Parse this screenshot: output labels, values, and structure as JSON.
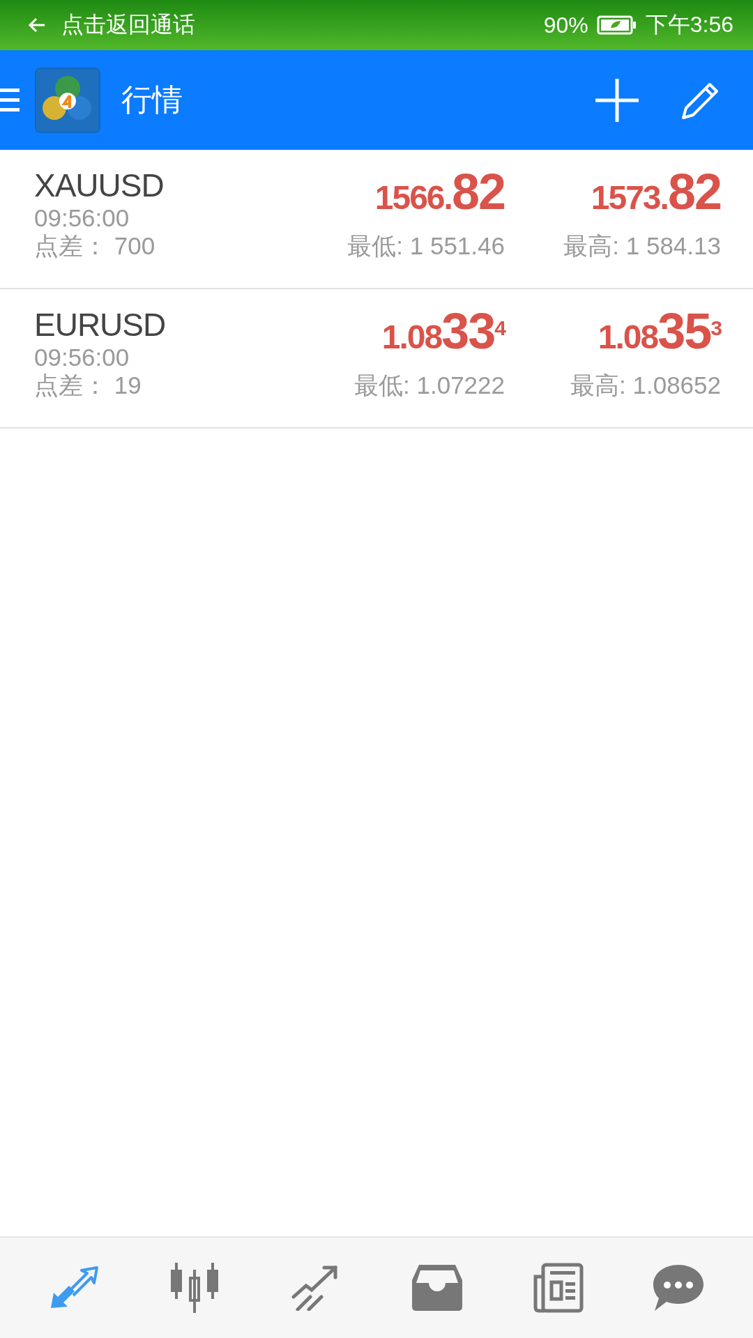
{
  "status_bar": {
    "back_label": "点击返回通话",
    "battery": "90%",
    "time": "下午3:56"
  },
  "toolbar": {
    "title": "行情"
  },
  "quotes": [
    {
      "symbol": "XAUUSD",
      "time": "09:56:00",
      "spread_label": "点差：",
      "spread": "700",
      "bid": {
        "prefix": "1566.",
        "big": "82"
      },
      "ask": {
        "prefix": "1573.",
        "big": "82"
      },
      "low": "最低: 1 551.46",
      "high": "最高: 1 584.13"
    },
    {
      "symbol": "EURUSD",
      "time": "09:56:00",
      "spread_label": "点差：",
      "spread": "19",
      "bid": {
        "prefix": "1.08",
        "big": "33",
        "sup": "4"
      },
      "ask": {
        "prefix": "1.08",
        "big": "35",
        "sup": "3"
      },
      "low": "最低: 1.07222",
      "high": "最高: 1.08652"
    }
  ],
  "bottom_nav": [
    {
      "kind": "quotes",
      "selected": true
    },
    {
      "kind": "chart",
      "selected": false
    },
    {
      "kind": "trade",
      "selected": false
    },
    {
      "kind": "history",
      "selected": false
    },
    {
      "kind": "news",
      "selected": false
    },
    {
      "kind": "chat",
      "selected": false
    }
  ]
}
